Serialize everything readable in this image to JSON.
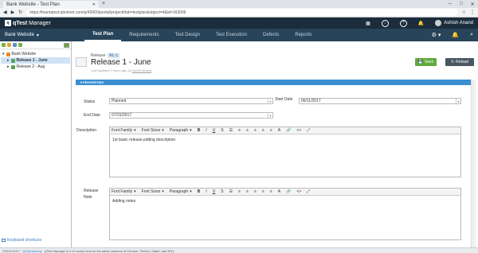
{
  "browser": {
    "tab_title": "Bank Website - Test Plan",
    "tab_close": "✕",
    "new_tab": "+",
    "win_min": "─",
    "win_max": "□",
    "win_close": "✕",
    "url": "https://learnqtest.qtestnet.com/p/42660/portal/project#tab=testplan&object=4&id=163006"
  },
  "app": {
    "logo_mark": "q",
    "logo_text": "qTest",
    "logo_product": "Manager",
    "user_name": "Ashish Anand"
  },
  "nav": {
    "project": "Bank Website",
    "project_caret": "▾",
    "tabs": [
      "Test Plan",
      "Requirements",
      "Test Design",
      "Test Execution",
      "Defects",
      "Reports"
    ],
    "active_tab": 0
  },
  "tree": {
    "collapse": "«",
    "root": "Bank Website",
    "items": [
      "Release 1 - June",
      "Release 2 - Aug"
    ],
    "selected": 0,
    "keyboard_shortcuts": "Keyboard shortcuts"
  },
  "page": {
    "breadcrumb": "Release",
    "breadcrumb_id": "RL-1",
    "title": "Release 1 - June",
    "updated_prefix": "Last updated 2 hours ago by",
    "updated_user": "Ashish Anand",
    "save_label": "Save",
    "reload_label": "Reload",
    "section_label": "▾ PROPERTIES"
  },
  "form": {
    "status_label": "Status",
    "status_value": "Planned",
    "start_label": "Start Date",
    "start_value": "06/11/2017",
    "end_label": "End Date",
    "end_value": "07/31/2017",
    "description_label": "Description",
    "description_value": "1st basic release,editing description",
    "note_label_1": "Release",
    "note_label_2": "Note",
    "note_value": "Adding notes"
  },
  "editor_toolbar": {
    "font_family": "Font Family",
    "font_sizes": "Font Sizes",
    "paragraph": "Paragraph",
    "bold": "B",
    "italic": "I",
    "underline": "U",
    "strike": "S",
    "bullets": "☰",
    "numbers": "≡",
    "align_left": "≡",
    "align_center": "≡",
    "align_right": "≡",
    "align_justify": "≡",
    "font_color": "A",
    "link": "🔗",
    "source": "<>",
    "fullscreen": "⤢"
  },
  "footer": {
    "copyright": "©2010-2017",
    "company": "QASymphony",
    "notice": "qTest Manager 8.4.10 works best on the latest versions of Chrome, Firefox, Safari, and IE11."
  },
  "colors": {
    "topbar": "#1b2d3c",
    "navbar": "#28445a",
    "save": "#5eab3c",
    "reload": "#4a5763",
    "section": "#3a8fd3"
  }
}
